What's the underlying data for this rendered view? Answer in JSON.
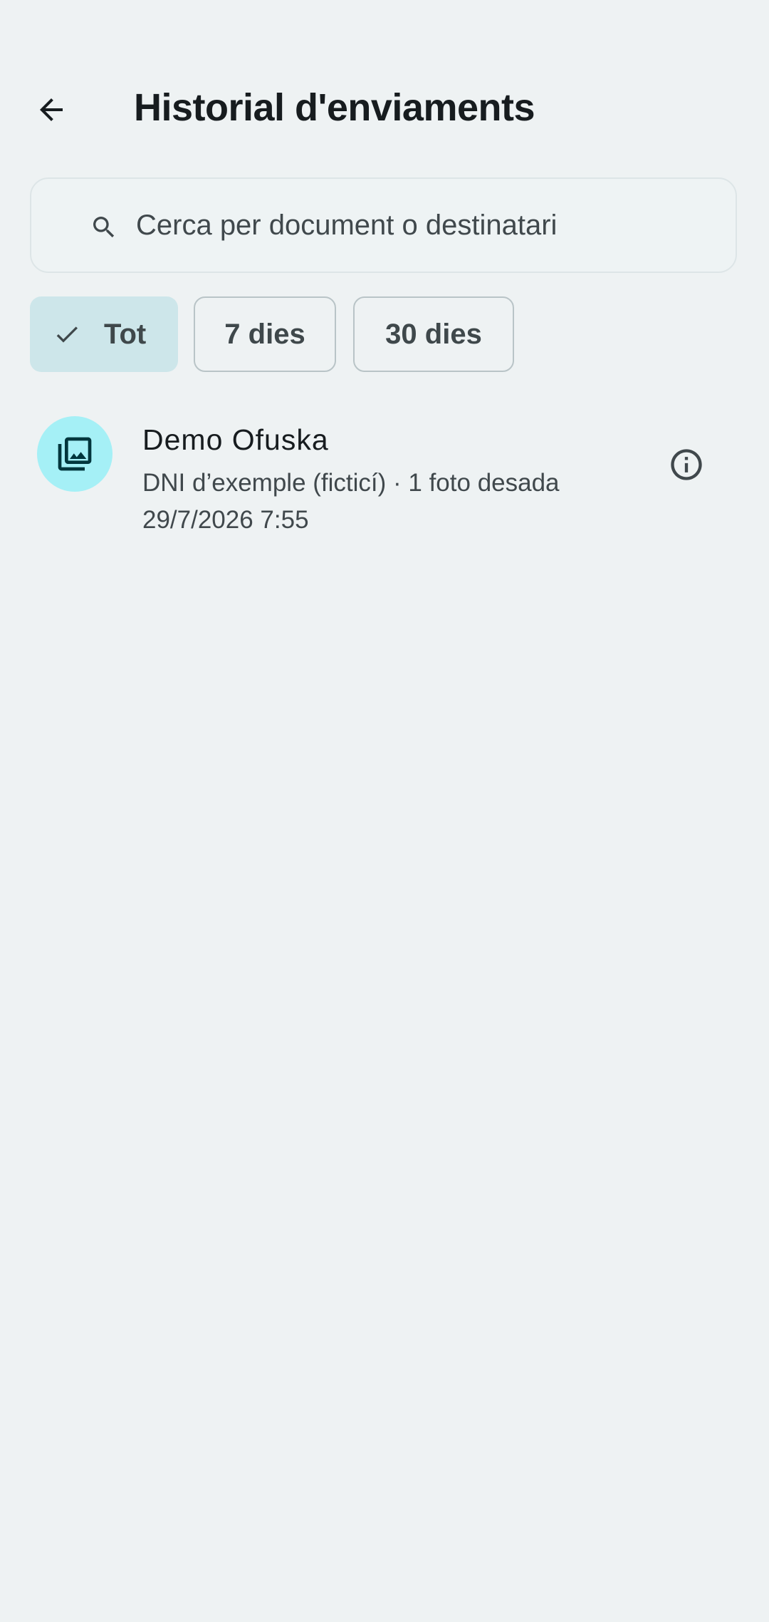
{
  "app_bar": {
    "title": "Historial d'enviaments",
    "back_icon": "arrow-back-icon"
  },
  "search": {
    "placeholder": "Cerca per document o destinatari",
    "value": "",
    "icon": "search-icon"
  },
  "filters": [
    {
      "label": "Tot",
      "selected": true,
      "icon": "check-icon"
    },
    {
      "label": "7 dies",
      "selected": false
    },
    {
      "label": "30 dies",
      "selected": false
    }
  ],
  "history": [
    {
      "title": "Demo Ofuska",
      "subtitle": "DNI d’exemple (ficticí) · 1 foto desada",
      "date": "29/7/2026 7:55",
      "icon": "photo-library-icon",
      "action_icon": "info-icon"
    }
  ],
  "colors": {
    "background": "#eef2f3",
    "selected_chip": "#cde6ea",
    "avatar": "#a5f0f6",
    "accent_dark": "#00363d"
  }
}
